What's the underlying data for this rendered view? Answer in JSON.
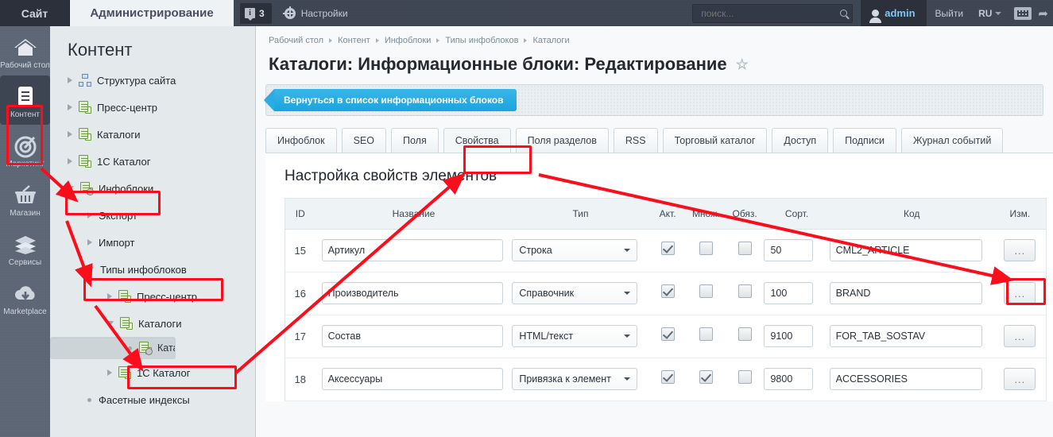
{
  "topbar": {
    "site_label": "Сайт",
    "admin_label": "Администрирование",
    "notify_icon": "info-icon",
    "notify_count": "3",
    "settings_icon": "gear-icon",
    "settings_label": "Настройки",
    "search_placeholder": "поиск...",
    "search_value": "",
    "search_icon": "search-icon",
    "user_icon": "user-icon",
    "user_label": "admin",
    "logout_label": "Выйти",
    "lang_label": "RU",
    "lang_caret_icon": "chevron-down-icon",
    "keyboard_icon": "keyboard-icon",
    "pin_icon": "pin-icon"
  },
  "rail": {
    "items": [
      {
        "label": "Рабочий стол",
        "icon": "home-icon",
        "active": false
      },
      {
        "label": "Контент",
        "icon": "document-icon",
        "active": true
      },
      {
        "label": "Маркетинг",
        "icon": "target-icon",
        "active": false
      },
      {
        "label": "Магазин",
        "icon": "basket-icon",
        "active": false
      },
      {
        "label": "Сервисы",
        "icon": "layers-icon",
        "active": false
      },
      {
        "label": "Marketplace",
        "icon": "cloud-download-icon",
        "active": false
      }
    ]
  },
  "tree": {
    "title": "Контент",
    "nodes": [
      {
        "label": "Структура сайта",
        "indent": 0,
        "toggle": "right",
        "icon": "sitemap-icon",
        "selected": false
      },
      {
        "label": "Пресс-центр",
        "indent": 0,
        "toggle": "right",
        "icon": "infoblock-icon",
        "selected": false
      },
      {
        "label": "Каталоги",
        "indent": 0,
        "toggle": "right",
        "icon": "infoblock-icon",
        "selected": false
      },
      {
        "label": "1С Каталог",
        "indent": 0,
        "toggle": "right",
        "icon": "infoblock-icon",
        "selected": false
      },
      {
        "label": "Инфоблоки",
        "indent": 0,
        "toggle": "down",
        "icon": "infoblock-gear-icon",
        "selected": false
      },
      {
        "label": "Экспорт",
        "indent": 1,
        "toggle": "right",
        "icon": "none",
        "selected": false
      },
      {
        "label": "Импорт",
        "indent": 1,
        "toggle": "right",
        "icon": "none",
        "selected": false
      },
      {
        "label": "Типы инфоблоков",
        "indent": 1,
        "toggle": "down",
        "icon": "none",
        "selected": false
      },
      {
        "label": "Пресс-центр",
        "indent": 2,
        "toggle": "right",
        "icon": "infoblock-icon",
        "selected": false
      },
      {
        "label": "Каталоги",
        "indent": 2,
        "toggle": "down",
        "icon": "infoblock-icon",
        "selected": false
      },
      {
        "label": "Каталог товаров",
        "indent": 3,
        "toggle": "dot",
        "icon": "infoblock-gear-icon",
        "selected": true
      },
      {
        "label": "1С Каталог",
        "indent": 2,
        "toggle": "right",
        "icon": "infoblock-icon",
        "selected": false
      },
      {
        "label": "Фасетные индексы",
        "indent": 1,
        "toggle": "dot",
        "icon": "none",
        "selected": false
      }
    ]
  },
  "main": {
    "breadcrumb": [
      "Рабочий стол",
      "Контент",
      "Инфоблоки",
      "Типы инфоблоков",
      "Каталоги"
    ],
    "page_title": "Каталоги: Информационные блоки: Редактирование",
    "favorite_icon": "star-icon",
    "back_button": "Вернуться в список информационных блоков",
    "tabs": [
      {
        "label": "Инфоблок",
        "active": false
      },
      {
        "label": "SEO",
        "active": false
      },
      {
        "label": "Поля",
        "active": false
      },
      {
        "label": "Свойства",
        "active": true
      },
      {
        "label": "Поля разделов",
        "active": false
      },
      {
        "label": "RSS",
        "active": false
      },
      {
        "label": "Торговый каталог",
        "active": false
      },
      {
        "label": "Доступ",
        "active": false
      },
      {
        "label": "Подписи",
        "active": false
      },
      {
        "label": "Журнал событий",
        "active": false
      }
    ],
    "section_title": "Настройка свойств элементов",
    "table": {
      "columns": [
        "ID",
        "Название",
        "Тип",
        "Акт.",
        "Множ.",
        "Обяз.",
        "Сорт.",
        "Код",
        "Изм."
      ],
      "rows": [
        {
          "id": "15",
          "name": "Артикул",
          "type": "Строка",
          "active": true,
          "multiple": false,
          "required": false,
          "sort": "50",
          "code": "CML2_ARTICLE",
          "edit": "..."
        },
        {
          "id": "16",
          "name": "Производитель",
          "type": "Справочник",
          "active": true,
          "multiple": false,
          "required": false,
          "sort": "100",
          "code": "BRAND",
          "edit": "..."
        },
        {
          "id": "17",
          "name": "Состав",
          "type": "HTML/текст",
          "active": true,
          "multiple": false,
          "required": false,
          "sort": "9100",
          "code": "FOR_TAB_SOSTAV",
          "edit": "..."
        },
        {
          "id": "18",
          "name": "Аксессуары",
          "type": "Привязка к элемент",
          "active": true,
          "multiple": true,
          "required": false,
          "sort": "9800",
          "code": "ACCESSORIES",
          "edit": "..."
        }
      ]
    }
  },
  "annotations": {
    "highlight_color": "#fc0d1b",
    "boxes": [
      "rail-item-content",
      "tree-node-infoblocks",
      "tree-node-infoblock-types",
      "tree-node-product-catalog",
      "tab-properties",
      "row-edit-button"
    ]
  }
}
